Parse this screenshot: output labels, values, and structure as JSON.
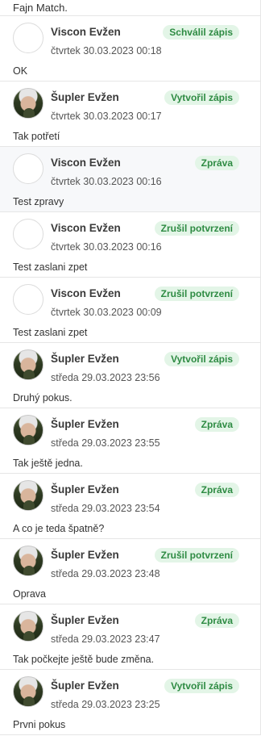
{
  "top_fragment": "Fajn Match.",
  "items": [
    {
      "author": "Viscon Evžen",
      "avatar": "empty",
      "date": "čtvrtek 30.03.2023 00:18",
      "badge": "Schválil zápis",
      "message": "OK"
    },
    {
      "author": "Šupler Evžen",
      "avatar": "photo",
      "date": "čtvrtek 30.03.2023 00:17",
      "badge": "Vytvořil zápis",
      "message": "Tak potřetí"
    },
    {
      "author": "Viscon Evžen",
      "avatar": "empty",
      "date": "čtvrtek 30.03.2023 00:16",
      "badge": "Zpráva",
      "message": "Test zpravy"
    },
    {
      "author": "Viscon Evžen",
      "avatar": "empty",
      "date": "čtvrtek 30.03.2023 00:16",
      "badge": "Zrušil potvrzení",
      "message": "Test zaslani zpet"
    },
    {
      "author": "Viscon Evžen",
      "avatar": "empty",
      "date": "čtvrtek 30.03.2023 00:09",
      "badge": "Zrušil potvrzení",
      "message": "Test zaslani zpet"
    },
    {
      "author": "Šupler Evžen",
      "avatar": "photo",
      "date": "středa 29.03.2023 23:56",
      "badge": "Vytvořil zápis",
      "message": "Druhý pokus."
    },
    {
      "author": "Šupler Evžen",
      "avatar": "photo",
      "date": "středa 29.03.2023 23:55",
      "badge": "Zpráva",
      "message": "Tak ještě jedna."
    },
    {
      "author": "Šupler Evžen",
      "avatar": "photo",
      "date": "středa 29.03.2023 23:54",
      "badge": "Zpráva",
      "message": "A co je teda špatně?"
    },
    {
      "author": "Šupler Evžen",
      "avatar": "photo",
      "date": "středa 29.03.2023 23:48",
      "badge": "Zrušil potvrzení",
      "message": "Oprava"
    },
    {
      "author": "Šupler Evžen",
      "avatar": "photo",
      "date": "středa 29.03.2023 23:47",
      "badge": "Zpráva",
      "message": "Tak počkejte ještě bude změna."
    },
    {
      "author": "Šupler Evžen",
      "avatar": "photo",
      "date": "středa 29.03.2023 23:25",
      "badge": "Vytvořil zápis",
      "message": "Prvni pokus"
    }
  ]
}
